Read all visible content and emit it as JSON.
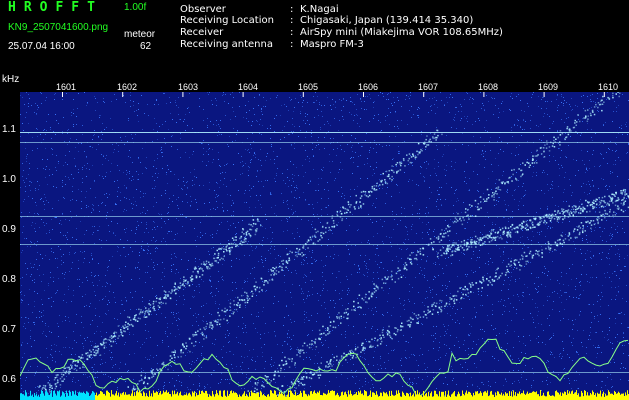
{
  "header": {
    "app_title": "HROFFT",
    "version": "1.00f",
    "filename": "KN9_2507041600.png",
    "datetime": "25.07.04 16:00",
    "meteor_label": "meteor",
    "meteor_count": "62"
  },
  "metadata": [
    {
      "key": "Observer",
      "value": "K.Nagai"
    },
    {
      "key": "Receiving Location",
      "value": "Chigasaki, Japan (139.414 35.340)"
    },
    {
      "key": "Receiver",
      "value": "AirSpy mini (Miakejima VOR 108.65MHz)"
    },
    {
      "key": "Receiving antenna",
      "value": "Maspro FM-3"
    }
  ],
  "chart_data": {
    "type": "heatmap",
    "ylabel": "kHz",
    "y_ticks": [
      "1.1",
      "1.0",
      "0.9",
      "0.8",
      "0.7",
      "0.6"
    ],
    "x_ticks": [
      "1601",
      "1602",
      "1603",
      "1604",
      "1605",
      "1606",
      "1607",
      "1608",
      "1609",
      "1610"
    ],
    "colors": {
      "background": "#0a1680",
      "noise": "#3a78ff",
      "signal": "#aef0ff",
      "trace": "#88ff88",
      "bottom_bar": "#ffff00",
      "bottom_bar_alt": "#00e0ff"
    }
  }
}
